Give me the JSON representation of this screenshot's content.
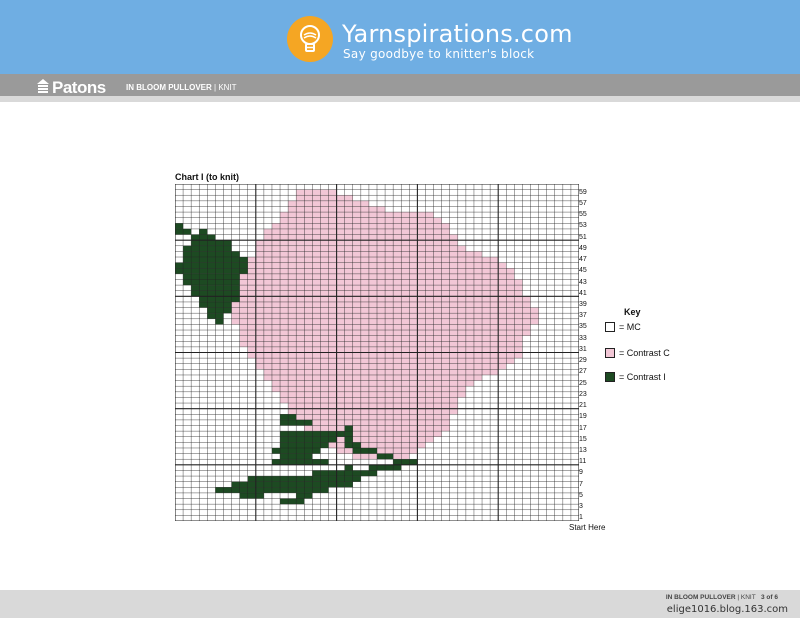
{
  "header": {
    "site_name": "Yarnspirations.com",
    "tagline": "Say goodbye to knitter's block",
    "logo_icon": "lightbulb-yarn-icon",
    "logo_color": "#f5a623",
    "banner_color": "#6faee3"
  },
  "subheader": {
    "brand": "Patons",
    "pattern_name": "IN BLOOM PULLOVER",
    "separator": " | ",
    "craft": "KNIT"
  },
  "chart": {
    "title": "Chart I (to knit)",
    "row_numbers": [
      "59",
      "57",
      "55",
      "53",
      "51",
      "49",
      "47",
      "45",
      "43",
      "41",
      "39",
      "37",
      "35",
      "33",
      "31",
      "29",
      "27",
      "25",
      "23",
      "21",
      "19",
      "17",
      "15",
      "13",
      "11",
      "9",
      "7",
      "5",
      "3",
      "1"
    ],
    "start_label": "Start Here"
  },
  "key": {
    "title": "Key",
    "items": [
      {
        "label": "= MC",
        "color": "#ffffff"
      },
      {
        "label": "= Contrast C",
        "color": "#f2c7d6"
      },
      {
        "label": "= Contrast I",
        "color": "#1d4a22"
      }
    ]
  },
  "chart_data": {
    "type": "table",
    "columns": 50,
    "rows": 60,
    "colors": {
      "MC": "#ffffff",
      "Contrast C": "#f2c7d6",
      "Contrast I": "#1d4a22"
    },
    "fills": [
      {
        "color": "Contrast C",
        "row_ranges": [
          [
            59,
            58,
            15,
            20
          ],
          [
            58,
            57,
            15,
            22
          ],
          [
            57,
            56,
            14,
            24
          ],
          [
            56,
            55,
            14,
            26
          ],
          [
            55,
            54,
            13,
            32
          ],
          [
            54,
            53,
            13,
            33
          ],
          [
            53,
            52,
            12,
            34
          ],
          [
            52,
            51,
            11,
            34
          ],
          [
            51,
            50,
            11,
            35
          ],
          [
            50,
            49,
            10,
            35
          ],
          [
            49,
            48,
            10,
            36
          ],
          [
            48,
            47,
            10,
            38
          ],
          [
            47,
            46,
            9,
            40
          ],
          [
            46,
            45,
            9,
            41
          ],
          [
            45,
            44,
            9,
            42
          ],
          [
            44,
            43,
            8,
            42
          ],
          [
            43,
            42,
            8,
            43
          ],
          [
            42,
            41,
            8,
            43
          ],
          [
            41,
            40,
            8,
            43
          ],
          [
            40,
            39,
            7,
            44
          ],
          [
            39,
            38,
            7,
            44
          ],
          [
            38,
            37,
            7,
            45
          ],
          [
            37,
            36,
            7,
            45
          ],
          [
            36,
            35,
            7,
            45
          ],
          [
            35,
            34,
            8,
            44
          ],
          [
            34,
            33,
            8,
            44
          ],
          [
            33,
            32,
            8,
            43
          ],
          [
            32,
            31,
            8,
            43
          ],
          [
            31,
            30,
            9,
            43
          ],
          [
            30,
            29,
            9,
            43
          ],
          [
            29,
            28,
            10,
            42
          ],
          [
            28,
            27,
            10,
            41
          ],
          [
            27,
            26,
            11,
            40
          ],
          [
            26,
            25,
            11,
            38
          ],
          [
            25,
            24,
            12,
            37
          ],
          [
            24,
            23,
            12,
            36
          ],
          [
            23,
            22,
            13,
            36
          ],
          [
            22,
            21,
            13,
            35
          ],
          [
            21,
            20,
            14,
            35
          ],
          [
            20,
            19,
            14,
            35
          ],
          [
            19,
            18,
            15,
            34
          ],
          [
            18,
            17,
            16,
            34
          ],
          [
            17,
            16,
            16,
            34
          ],
          [
            16,
            15,
            17,
            33
          ],
          [
            15,
            14,
            18,
            32
          ],
          [
            14,
            13,
            19,
            31
          ],
          [
            13,
            12,
            20,
            30
          ],
          [
            12,
            11,
            22,
            29
          ]
        ]
      },
      {
        "color": "Contrast I",
        "row_ranges": [
          [
            36,
            35,
            5,
            6
          ],
          [
            37,
            36,
            4,
            6
          ],
          [
            38,
            37,
            4,
            7
          ],
          [
            39,
            38,
            3,
            7
          ],
          [
            40,
            39,
            3,
            8
          ],
          [
            41,
            40,
            2,
            8
          ],
          [
            42,
            41,
            2,
            8
          ],
          [
            43,
            42,
            1,
            8
          ],
          [
            44,
            43,
            1,
            8
          ],
          [
            45,
            44,
            0,
            9
          ],
          [
            46,
            45,
            0,
            9
          ],
          [
            47,
            46,
            1,
            9
          ],
          [
            48,
            47,
            1,
            8
          ],
          [
            49,
            48,
            1,
            7
          ],
          [
            50,
            49,
            2,
            6
          ],
          [
            51,
            50,
            2,
            5
          ],
          [
            52,
            51,
            3,
            4
          ],
          [
            50,
            49,
            6,
            7
          ],
          [
            52,
            51,
            0,
            2
          ],
          [
            53,
            52,
            0,
            1
          ],
          [
            12,
            11,
            13,
            17
          ],
          [
            13,
            12,
            12,
            18
          ],
          [
            14,
            13,
            13,
            19
          ],
          [
            15,
            14,
            13,
            20
          ],
          [
            16,
            15,
            13,
            21
          ],
          [
            17,
            14,
            21,
            22
          ],
          [
            14,
            13,
            21,
            23
          ],
          [
            13,
            12,
            22,
            25
          ],
          [
            12,
            11,
            25,
            27
          ],
          [
            11,
            10,
            27,
            30
          ],
          [
            10,
            9,
            24,
            28
          ],
          [
            9,
            8,
            17,
            25
          ],
          [
            8,
            7,
            9,
            23
          ],
          [
            7,
            6,
            7,
            21
          ],
          [
            6,
            5,
            5,
            19
          ],
          [
            5,
            4,
            8,
            11
          ],
          [
            4,
            3,
            13,
            16
          ],
          [
            5,
            4,
            15,
            17
          ],
          [
            7,
            6,
            21,
            22
          ],
          [
            10,
            9,
            21,
            22
          ],
          [
            11,
            10,
            12,
            19
          ],
          [
            18,
            17,
            13,
            17
          ],
          [
            19,
            18,
            13,
            15
          ]
        ]
      }
    ]
  },
  "footer": {
    "pattern_name": "IN BLOOM PULLOVER",
    "craft": "KNIT",
    "page": "3 of 6",
    "watermark": "elige1016.blog.163.com"
  }
}
